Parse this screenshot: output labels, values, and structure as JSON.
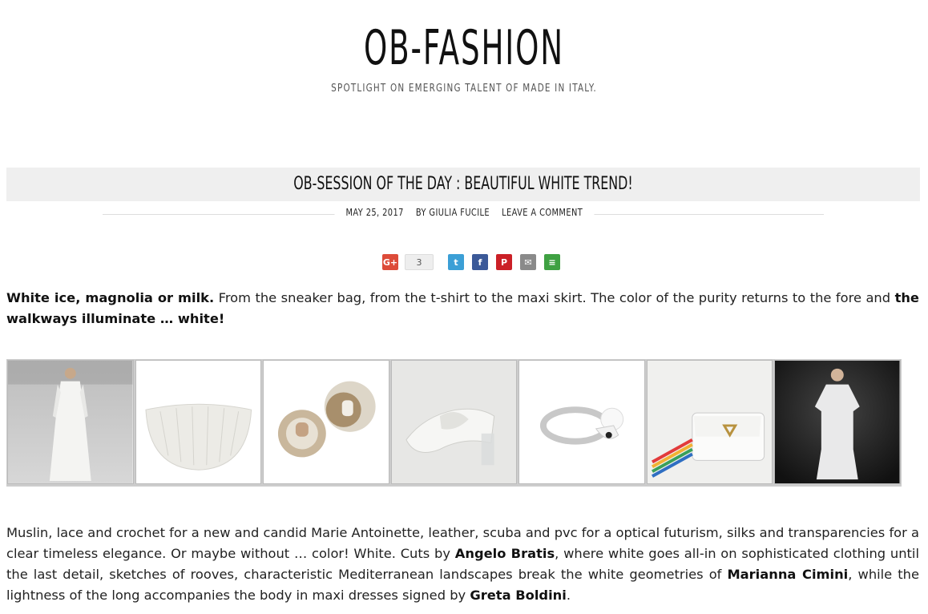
{
  "header": {
    "title": "OB-FASHION",
    "tagline": "SPOTLIGHT ON EMERGING TALENT OF MADE IN ITALY."
  },
  "post": {
    "title": "OB-SESSION OF THE DAY : BEAUTIFUL WHITE TREND!",
    "date": "MAY 25, 2017",
    "author": "BY GIULIA FUCILE",
    "comment": "LEAVE A COMMENT"
  },
  "share": {
    "count": "3",
    "buttons": [
      {
        "icon": "google-plus-icon",
        "glyph": "G+",
        "color": "#dd4b39"
      },
      {
        "icon": "twitter-icon",
        "glyph": "t",
        "color": "#3b9fd6"
      },
      {
        "icon": "facebook-icon",
        "glyph": "f",
        "color": "#3b5998"
      },
      {
        "icon": "pinterest-icon",
        "glyph": "P",
        "color": "#cb2027"
      },
      {
        "icon": "email-icon",
        "glyph": "✉",
        "color": "#8a8a8a"
      },
      {
        "icon": "more-icon",
        "glyph": "≡",
        "color": "#3fa142"
      }
    ]
  },
  "intro": {
    "bold1": "White ice,  magnolia or milk.",
    "text1": " From the sneaker bag, from the t-shirt to the maxi skirt. The color of the purity returns to the fore and ",
    "bold2": "the walkways illuminate … white!"
  },
  "gallery": {
    "items": [
      "white-dress-runway",
      "white-half-moon-bag",
      "earrings",
      "white-sandal",
      "pearl-ring",
      "white-bag-rainbow-strap",
      "white-dress-model"
    ]
  },
  "body": {
    "t1": "Muslin, lace and crochet for a new and candid Marie Antoinette, leather, scuba and pvc for a optical futurism, silks and transparencies for a clear timeless elegance. Or maybe without … color! White. Cuts by ",
    "b1": "Angelo Bratis",
    "t2": ", where white goes all-in on sophisticated clothing until the last detail, sketches of rooves, characteristic Mediterranean landscapes break the white geometries of ",
    "b2": "Marianna Cimini",
    "t3": ", while the lightness of the long accompanies the body in maxi dresses signed by ",
    "b3": "Greta Boldini",
    "t4": "."
  }
}
